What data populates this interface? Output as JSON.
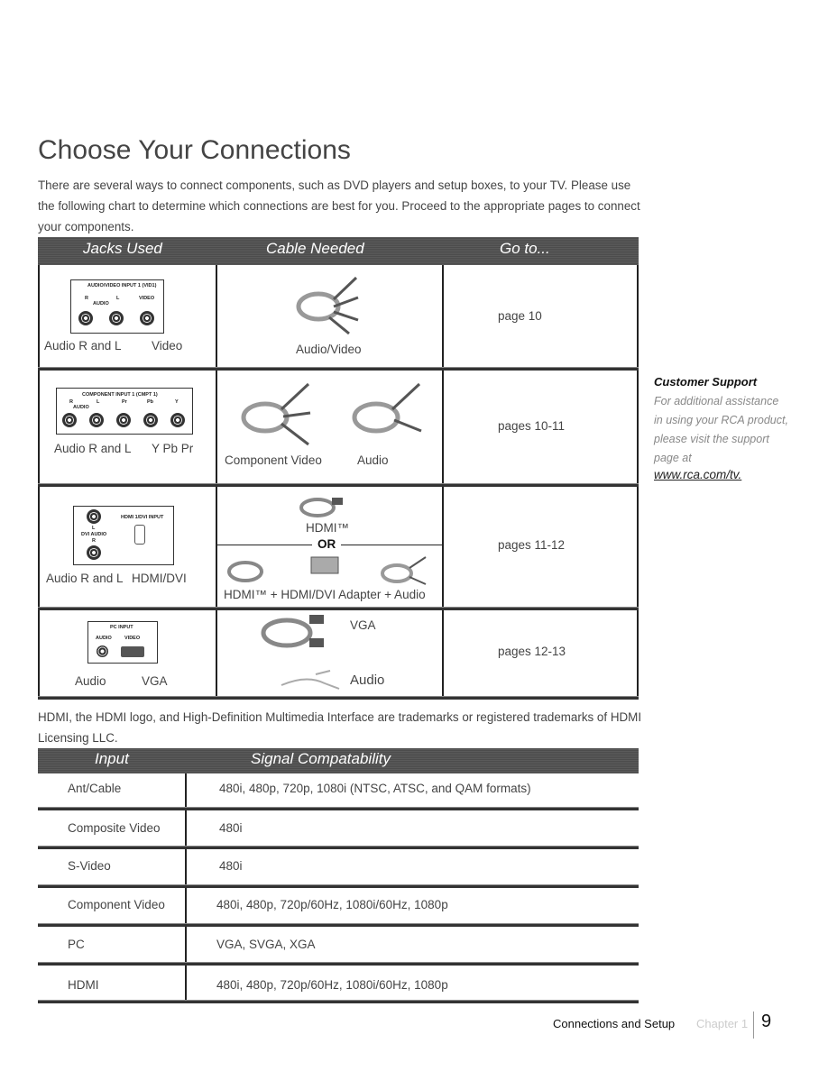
{
  "title": "Choose Your Connections",
  "intro": "There are several ways to connect components, such as DVD players and setup boxes, to your TV. Please use the following chart to determine which connections are best for you. Proceed to the appropriate pages to connect your components.",
  "connections_table": {
    "headers": [
      "Jacks Used",
      "Cable Needed",
      "Go to..."
    ],
    "rows": [
      {
        "panel_title": "AUDIO/VIDEO INPUT 1 (VID1)",
        "panel_labels": [
          "R",
          "AUDIO",
          "L",
          "VIDEO"
        ],
        "jacks_caption_1": "Audio R and L",
        "jacks_caption_2": "Video",
        "cable": "Audio/Video",
        "goto": "page 10"
      },
      {
        "panel_title": "COMPONENT INPUT 1 (CMPT 1)",
        "panel_labels": [
          "R",
          "AUDIO",
          "L",
          "Pr",
          "Pb",
          "Y"
        ],
        "jacks_caption_1": "Audio R and L",
        "jacks_caption_2": "Y Pb Pr",
        "cable": "Component Video",
        "cable_2": "Audio",
        "goto": "pages 10-11"
      },
      {
        "panel_title": "HDMI 1/DVI INPUT",
        "panel_labels": [
          "L",
          "DVI AUDIO",
          "R"
        ],
        "jacks_caption_1": "Audio R and L",
        "jacks_caption_2": "HDMI/DVI",
        "cable": "HDMI™",
        "or": "OR",
        "cable_2": "HDMI™ + HDMI/DVI Adapter + Audio",
        "goto": "pages 11-12"
      },
      {
        "panel_title": "PC INPUT",
        "panel_labels": [
          "AUDIO",
          "VIDEO"
        ],
        "jacks_caption_1": "Audio",
        "jacks_caption_2": "VGA",
        "cable": "VGA",
        "cable_2": "Audio",
        "goto": "pages 12-13"
      }
    ]
  },
  "trademark_note": "HDMI, the HDMI logo, and High-Definition Multimedia Interface are trademarks or registered trademarks of HDMI Licensing LLC.",
  "signal_table": {
    "headers": [
      "Input",
      "Signal Compatability"
    ],
    "rows": [
      {
        "input": "Ant/Cable",
        "signal": "480i, 480p, 720p, 1080i (NTSC, ATSC, and QAM formats)"
      },
      {
        "input": "Composite Video",
        "signal": "480i"
      },
      {
        "input": "S-Video",
        "signal": "480i"
      },
      {
        "input": "Component  Video",
        "signal": "480i, 480p, 720p/60Hz, 1080i/60Hz, 1080p"
      },
      {
        "input": "PC",
        "signal": "VGA, SVGA, XGA"
      },
      {
        "input": "HDMI",
        "signal": "480i, 480p, 720p/60Hz, 1080i/60Hz, 1080p"
      }
    ]
  },
  "customer_support": {
    "heading": "Customer Support",
    "body": "For additional assistance in using your RCA product, please visit the support page at",
    "link": "www.rca.com/tv."
  },
  "footer": {
    "section": "Connections and Setup",
    "chapter": "Chapter 1",
    "page": "9"
  }
}
